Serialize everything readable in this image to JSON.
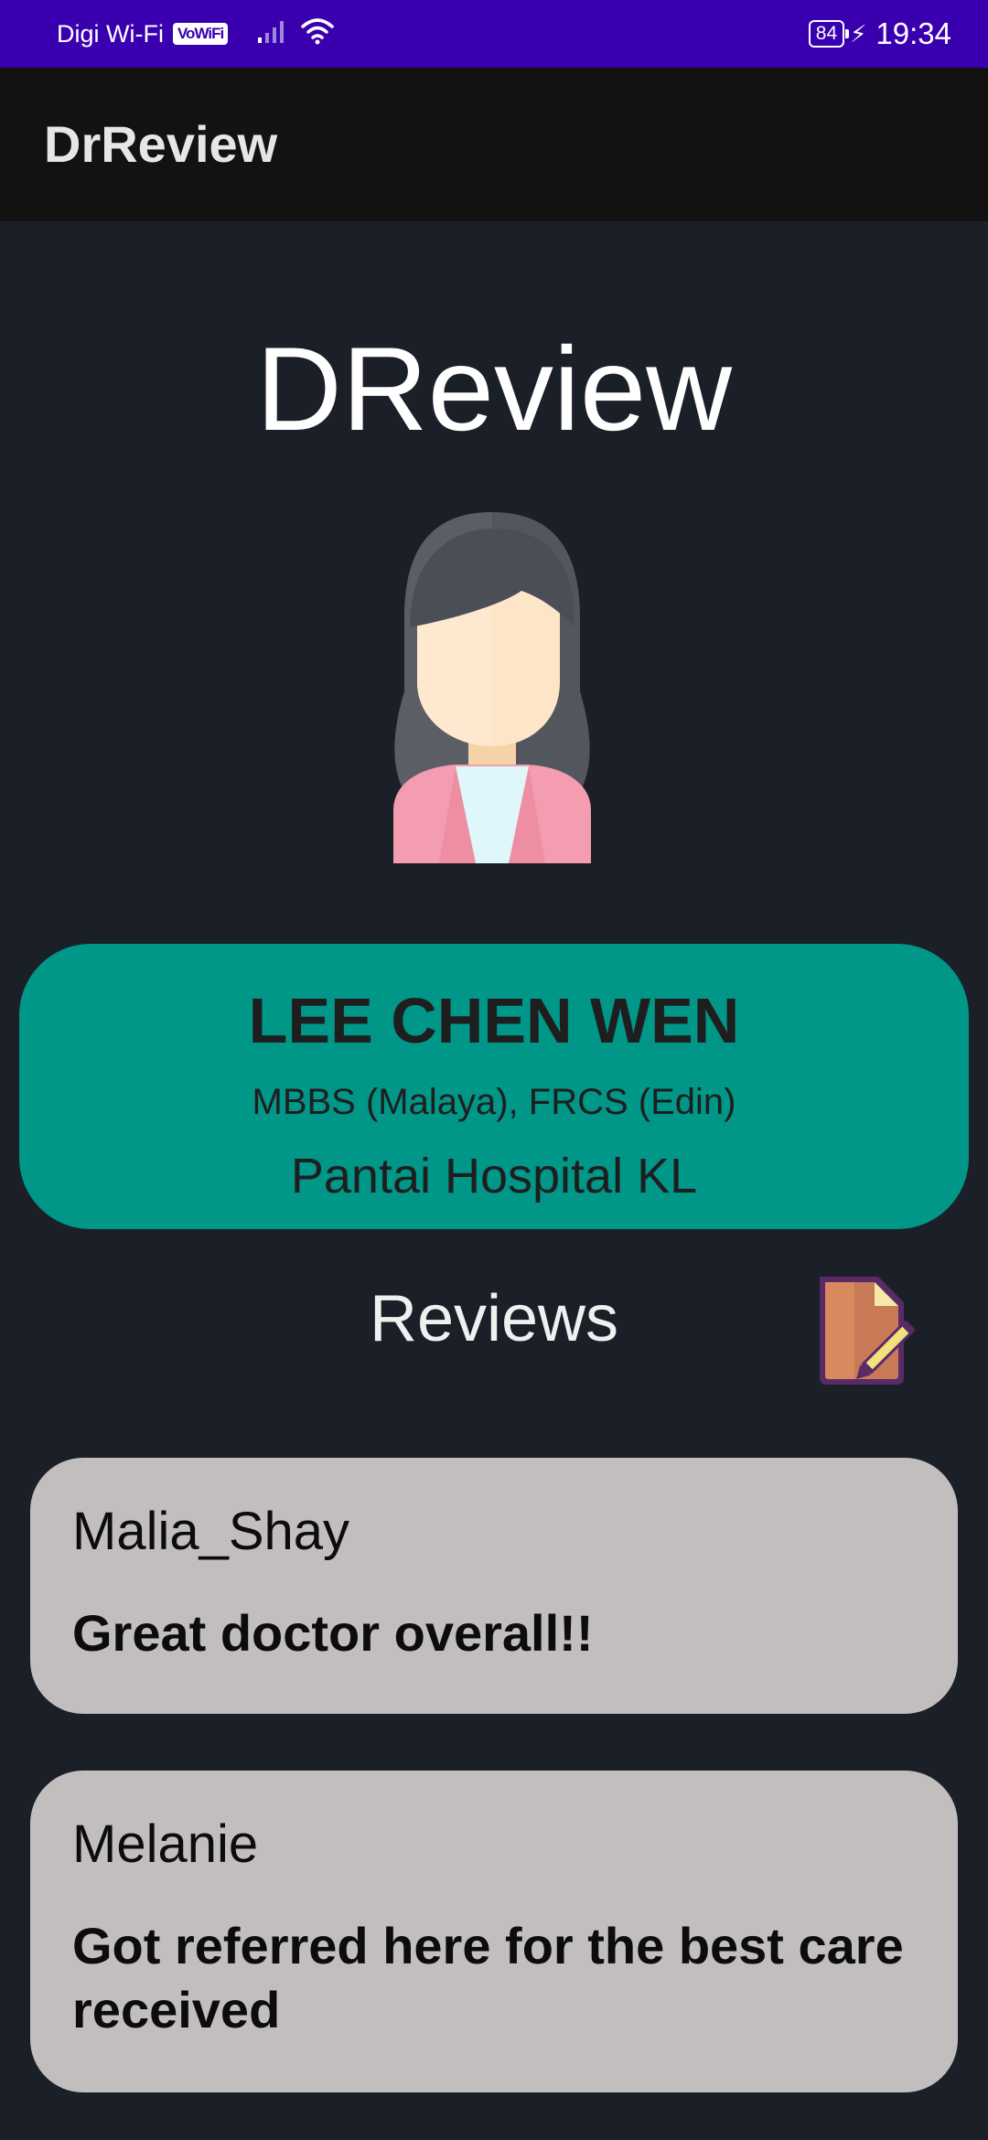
{
  "status_bar": {
    "carrier": "Digi Wi-Fi",
    "vowifi_badge": "VoWiFi",
    "battery": "84",
    "time": "19:34",
    "icons": [
      "signal-icon",
      "wifi-icon",
      "battery-icon",
      "charging-bolt-icon"
    ]
  },
  "app_bar": {
    "title": "DrReview"
  },
  "main": {
    "heading": "DReview",
    "avatar_icon": "female-doctor-avatar-icon"
  },
  "doctor": {
    "name": "LEE CHEN WEN",
    "qualifications": "MBBS (Malaya), FRCS (Edin)",
    "hospital": "Pantai Hospital KL"
  },
  "reviews_section": {
    "title": "Reviews",
    "write_icon": "write-review-icon"
  },
  "reviews": [
    {
      "user": "Malia_Shay",
      "text": "Great doctor overall!!"
    },
    {
      "user": "Melanie",
      "text": "Got referred here for the best care received"
    }
  ],
  "colors": {
    "status_bar": "#3a00b0",
    "app_bar": "#121212",
    "background": "#1b1f28",
    "doctor_card": "#009688",
    "review_card": "#c2bebe"
  }
}
